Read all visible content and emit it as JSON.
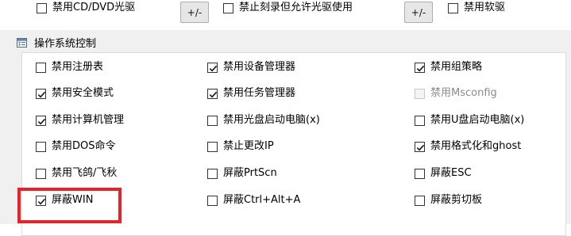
{
  "top_row": {
    "items": [
      {
        "label": "禁用CD/DVD光驱",
        "checked": false
      },
      {
        "label": "禁止刻录但允许光驱使用",
        "checked": false
      },
      {
        "label": "禁用软驱",
        "checked": false
      }
    ],
    "pm_buttons": [
      "+/-",
      "+/-"
    ]
  },
  "section": {
    "icon": "settings-list-icon",
    "title": "操作系统控制",
    "rows": [
      [
        {
          "label": "禁用注册表",
          "checked": false,
          "disabled": false
        },
        {
          "label": "禁用设备管理器",
          "checked": true,
          "disabled": false
        },
        {
          "label": "禁用组策略",
          "checked": true,
          "disabled": false
        }
      ],
      [
        {
          "label": "禁用安全模式",
          "checked": true,
          "disabled": false
        },
        {
          "label": "禁用任务管理器",
          "checked": true,
          "disabled": false
        },
        {
          "label": "禁用Msconfig",
          "checked": false,
          "disabled": true
        }
      ],
      [
        {
          "label": "禁用计算机管理",
          "checked": true,
          "disabled": false
        },
        {
          "label": "禁用光盘启动电脑(x)",
          "checked": false,
          "disabled": false
        },
        {
          "label": "禁用U盘启动电脑(x)",
          "checked": false,
          "disabled": false
        }
      ],
      [
        {
          "label": "禁用DOS命令",
          "checked": false,
          "disabled": false
        },
        {
          "label": "禁止更改IP",
          "checked": false,
          "disabled": false
        },
        {
          "label": "禁用格式化和ghost",
          "checked": true,
          "disabled": false
        }
      ],
      [
        {
          "label": "禁用飞鸽/飞秋",
          "checked": false,
          "disabled": false
        },
        {
          "label": "屏蔽PrtScn",
          "checked": false,
          "disabled": false
        },
        {
          "label": "屏蔽ESC",
          "checked": false,
          "disabled": false
        }
      ],
      [
        {
          "label": "屏蔽WIN",
          "checked": true,
          "disabled": false
        },
        {
          "label": "屏蔽Ctrl+Alt+A",
          "checked": false,
          "disabled": false
        },
        {
          "label": "屏蔽剪切板",
          "checked": false,
          "disabled": false
        }
      ]
    ]
  },
  "colors": {
    "highlight": "#e8222a",
    "panel_bg": "#f0f0f0",
    "checkbox_border": "#333333",
    "disabled_text": "#8a8a8a"
  }
}
